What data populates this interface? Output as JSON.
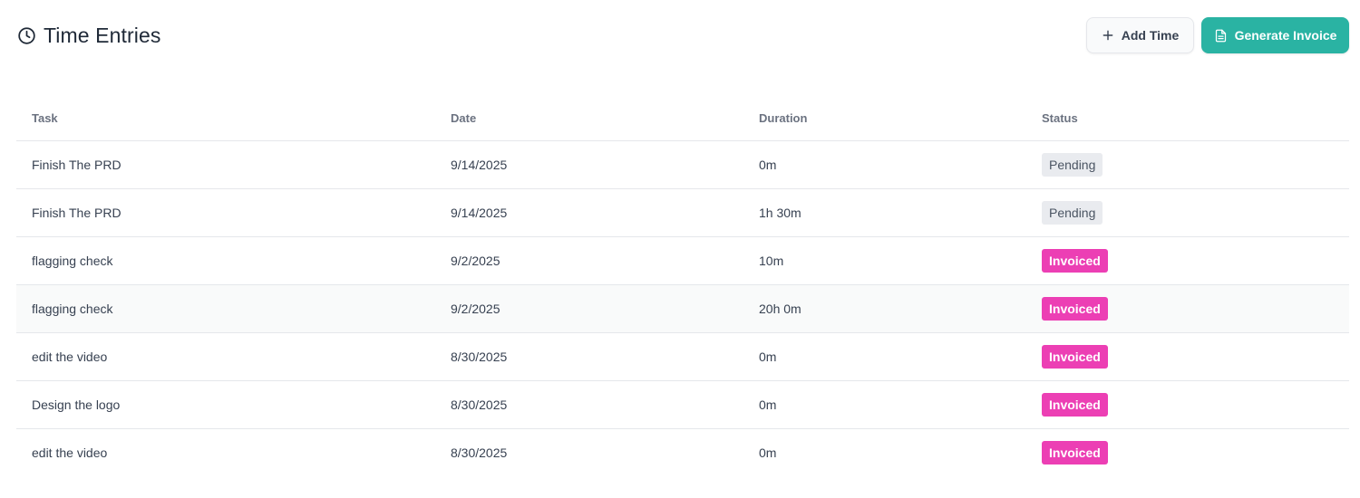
{
  "header": {
    "title": "Time Entries",
    "title_icon": "clock-icon",
    "add_time_label": "Add Time",
    "add_time_icon": "plus-icon",
    "generate_invoice_label": "Generate Invoice",
    "generate_invoice_icon": "document-icon"
  },
  "colors": {
    "primary": "#2ab3a3",
    "invoiced": "#ec3fb4",
    "pending_bg": "#e9ebef"
  },
  "table": {
    "columns": {
      "task": "Task",
      "date": "Date",
      "duration": "Duration",
      "status": "Status"
    },
    "rows": [
      {
        "task": "Finish The PRD",
        "date": "9/14/2025",
        "duration": "0m",
        "status": "Pending"
      },
      {
        "task": "Finish The PRD",
        "date": "9/14/2025",
        "duration": "1h 30m",
        "status": "Pending"
      },
      {
        "task": "flagging check",
        "date": "9/2/2025",
        "duration": "10m",
        "status": "Invoiced"
      },
      {
        "task": "flagging check",
        "date": "9/2/2025",
        "duration": "20h 0m",
        "status": "Invoiced"
      },
      {
        "task": "edit the video",
        "date": "8/30/2025",
        "duration": "0m",
        "status": "Invoiced"
      },
      {
        "task": "Design the logo",
        "date": "8/30/2025",
        "duration": "0m",
        "status": "Invoiced"
      },
      {
        "task": "edit the video",
        "date": "8/30/2025",
        "duration": "0m",
        "status": "Invoiced"
      }
    ]
  }
}
